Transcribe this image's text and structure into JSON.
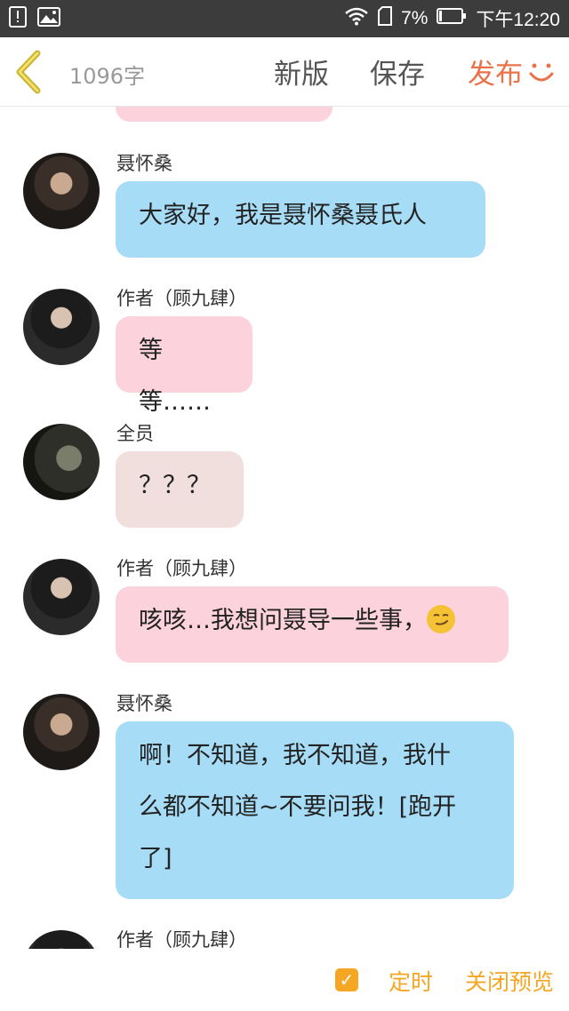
{
  "status_bar": {
    "battery_percent": "7%",
    "time": "下午12:20"
  },
  "header": {
    "word_count": "1096字",
    "new_version": "新版",
    "save": "保存",
    "publish": "发布"
  },
  "messages": [
    {
      "sender": "聂怀桑",
      "text": "大家好，我是聂怀桑聂氏人",
      "color": "#a7dcf6"
    },
    {
      "sender": "作者（顾九肆）",
      "text": "等等……",
      "color": "#fcd3dd"
    },
    {
      "sender": "全员",
      "text": "？？？",
      "color": "#f0dfdc"
    },
    {
      "sender": "作者（顾九肆）",
      "text": "咳咳…我想问聂导一些事，",
      "color": "#fcd3dd",
      "emoji": "smirk-emoji"
    },
    {
      "sender": "聂怀桑",
      "lines": [
        "啊！不知道，我不知道，我什",
        "么都不知道~不要问我！[跑开",
        "了]"
      ],
      "color": "#a7dcf6"
    },
    {
      "sender": "作者（顾九肆）"
    }
  ],
  "bottom_bar": {
    "timer": "定时",
    "close_preview": "关闭预览",
    "timer_checked": true
  },
  "colors": {
    "accent": "#e8724a",
    "checkbox": "#f5a623",
    "status_bar": "#3c3c3c"
  }
}
